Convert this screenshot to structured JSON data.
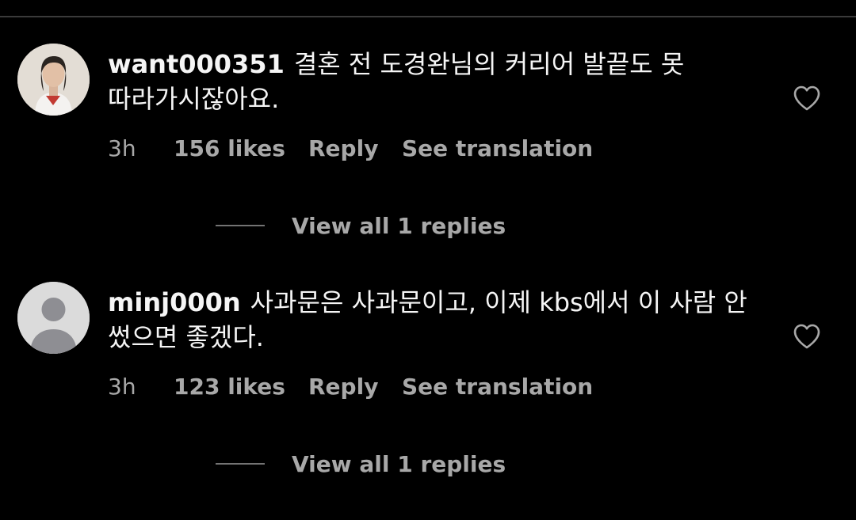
{
  "comments": [
    {
      "username": "want000351",
      "text": "결혼 전 도경완님의 커리어 발끝도 못 따라가시잖아요.",
      "time": "3h",
      "likes": "156 likes",
      "reply_label": "Reply",
      "translate_label": "See translation",
      "view_replies": "View all 1 replies",
      "avatar": "profile-photo"
    },
    {
      "username": "minj000n",
      "text": "사과문은 사과문이고, 이제 kbs에서 이 사람 안 썼으면 좋겠다.",
      "time": "3h",
      "likes": "123 likes",
      "reply_label": "Reply",
      "translate_label": "See translation",
      "view_replies": "View all 1 replies",
      "avatar": "default-avatar"
    }
  ],
  "icons": {
    "like": "heart-outline-icon"
  },
  "colors": {
    "background": "#000000",
    "primary_text": "#f5f5f5",
    "secondary_text": "#a8a8a8"
  }
}
